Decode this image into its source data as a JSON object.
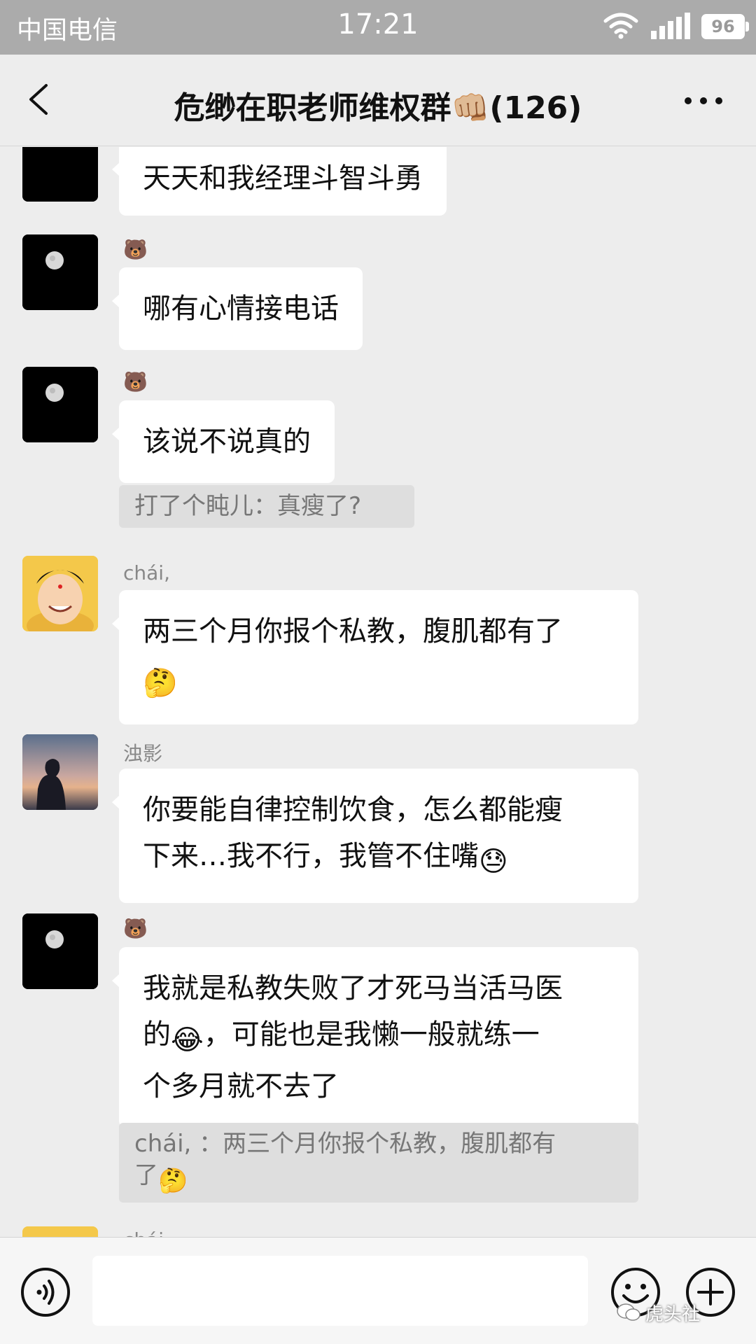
{
  "status_bar": {
    "carrier": "中国电信",
    "time": "17:21",
    "battery": "96"
  },
  "nav": {
    "title": "危缈在职老师维权群👊🏼(126)"
  },
  "messages": [
    {
      "text": "天天和我经理斗智斗勇"
    },
    {
      "sender": "🐻",
      "text": "哪有心情接电话"
    },
    {
      "sender": "🐻",
      "text": "该说不说真的"
    },
    {
      "quote": "打了个盹儿：真瘦了?"
    },
    {
      "sender": "chái,",
      "line1": "两三个月你报个私教，腹肌都有了",
      "emoji": "🤔"
    },
    {
      "sender": "浊影",
      "line1": "你要能自律控制饮食，怎么都能瘦",
      "line2": "下来…我不行，我管不住嘴",
      "emoji": "😓"
    },
    {
      "sender": "🐻",
      "line1": "我就是私教失败了才死马当活马医",
      "line2_a": "的",
      "emoji": "😂",
      "line2_b": "，可能也是我懒一般就练一",
      "line3": "个多月就不去了"
    },
    {
      "quote_line1": "chái,  ：两三个月你报个私教，腹肌都有",
      "quote_line2": "了",
      "emoji": "🤔"
    },
    {
      "sender": "chái,"
    }
  ],
  "input_bar": {
    "placeholder": ""
  },
  "watermark": "虎头社",
  "icons": [
    "back-arrow-icon",
    "more-icon",
    "voice-icon",
    "emoji-face-icon",
    "plus-icon",
    "wifi-icon",
    "signal-icon",
    "moon-icon",
    "wechat-icon"
  ],
  "colors": {
    "background": "#ededed",
    "bubble": "#ffffff",
    "quote": "#dedede",
    "status_bar": "#ababab"
  }
}
